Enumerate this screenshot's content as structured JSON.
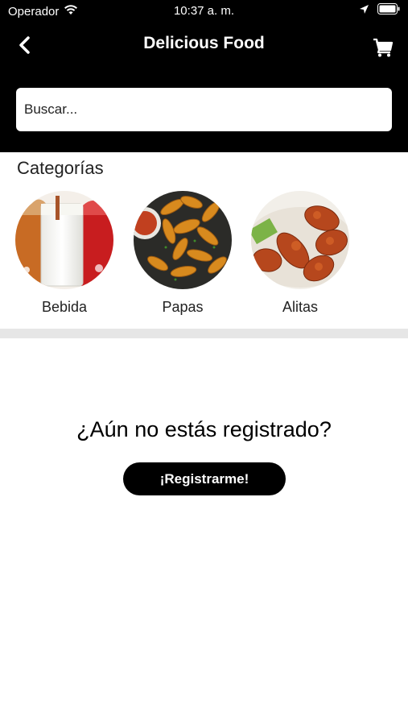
{
  "status_bar": {
    "carrier": "Operador",
    "time": "10:37 a. m.",
    "icons": [
      "wifi-icon",
      "location-arrow-icon",
      "battery-icon"
    ]
  },
  "nav": {
    "title": "Delicious Food",
    "back_icon": "chevron-left-icon",
    "cart_icon": "cart-icon"
  },
  "search": {
    "placeholder": "Buscar..."
  },
  "categories": {
    "title": "Categorías",
    "items": [
      {
        "label": "Bebida",
        "image": "milk-drink-image"
      },
      {
        "label": "Papas",
        "image": "potato-wedges-image"
      },
      {
        "label": "Alitas",
        "image": "chicken-wings-image"
      }
    ]
  },
  "register": {
    "question": "¿Aún no estás registrado?",
    "button_label": "¡Registrarme!"
  },
  "colors": {
    "header_bg": "#000000",
    "divider": "#e6e6e6",
    "button_bg": "#000000"
  }
}
